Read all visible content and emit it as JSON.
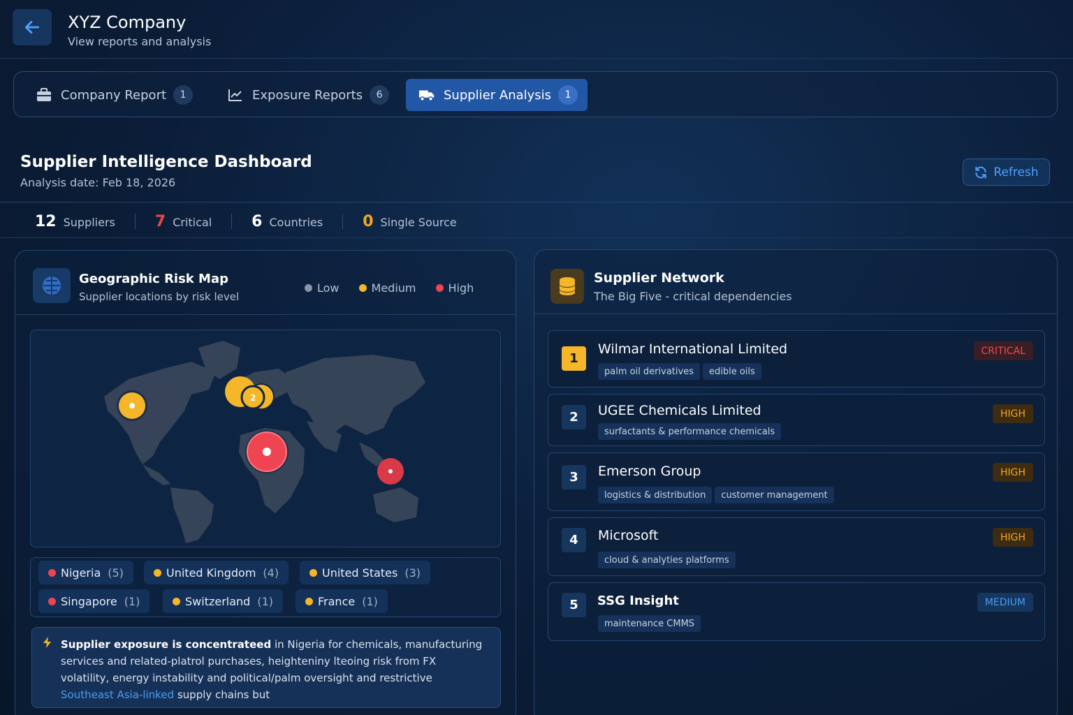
{
  "header": {
    "title": "XYZ Company",
    "subtitle": "View reports and analysis"
  },
  "tabs": [
    {
      "label": "Company Report",
      "count": "1",
      "icon": "briefcase-icon"
    },
    {
      "label": "Exposure Reports",
      "count": "6",
      "icon": "line-chart-icon"
    },
    {
      "label": "Supplier Analysis",
      "count": "1",
      "icon": "truck-icon",
      "active": true
    }
  ],
  "dashboard": {
    "title": "Supplier Intelligence Dashboard",
    "date": "Analysis date: Feb 18, 2026",
    "refresh_label": "Refresh"
  },
  "stats": [
    {
      "value": "12",
      "label": "Suppliers",
      "color": "#ffffff"
    },
    {
      "value": "7",
      "label": "Critical",
      "color": "#ef4444"
    },
    {
      "value": "6",
      "label": "Countries",
      "color": "#ffffff"
    },
    {
      "value": "0",
      "label": "Single Source",
      "color": "#f5a524"
    }
  ],
  "geo": {
    "title": "Geographic Risk Map",
    "subtitle": "Supplier locations by risk level",
    "legend": [
      {
        "label": "Low",
        "color": "#8a94a6"
      },
      {
        "label": "Medium",
        "color": "#f5b62a"
      },
      {
        "label": "High",
        "color": "#ef4452"
      }
    ],
    "markers": [
      {
        "region": "United States",
        "risk": "medium",
        "label": ""
      },
      {
        "region": "United Kingdom",
        "risk": "medium",
        "label": "2"
      },
      {
        "region": "Nigeria",
        "risk": "high",
        "label": ""
      },
      {
        "region": "Singapore",
        "risk": "high",
        "label": ""
      }
    ],
    "countries": [
      {
        "name": "Nigeria",
        "count": "(5)",
        "risk": "high"
      },
      {
        "name": "United Kingdom",
        "count": "(4)",
        "risk": "medium"
      },
      {
        "name": "United States",
        "count": "(3)",
        "risk": "medium"
      },
      {
        "name": "Singapore",
        "count": "(1)",
        "risk": "high"
      },
      {
        "name": "Switzerland",
        "count": "(1)",
        "risk": "medium"
      },
      {
        "name": "France",
        "count": "(1)",
        "risk": "medium"
      }
    ],
    "insight": {
      "bold": "Supplier exposure is concentrateed",
      "text": " in Nigeria for chemicals, manufacturing services and related-platrol purchases, heighteniny lteoing risk from FX volatility, energy instability and political/palm oversight and restrictive ",
      "link": "Southeast Asia-linked",
      "tail": " supply chains but"
    }
  },
  "network": {
    "title": "Supplier Network",
    "subtitle": "The Big Five - critical dependencies",
    "suppliers": [
      {
        "rank": "1",
        "name": "Wilmar International Limited",
        "tags": [
          "palm oil derivatives",
          "edible oils"
        ],
        "risk": "CRITICAL"
      },
      {
        "rank": "2",
        "name": "UGEE Chemicals Limited",
        "tags": [
          "surfactants & performance chemicals"
        ],
        "risk": "HIGH"
      },
      {
        "rank": "3",
        "name": "Emerson Group",
        "tags": [
          "logistics & distribution",
          "customer management"
        ],
        "risk": "HIGH"
      },
      {
        "rank": "4",
        "name": "Microsoft",
        "tags": [
          "cloud & analyties platforms"
        ],
        "risk": "HIGH"
      },
      {
        "rank": "5",
        "name": "SSG Insight",
        "tags": [
          "maintenance CMMS"
        ],
        "risk": "MEDIUM"
      }
    ]
  }
}
